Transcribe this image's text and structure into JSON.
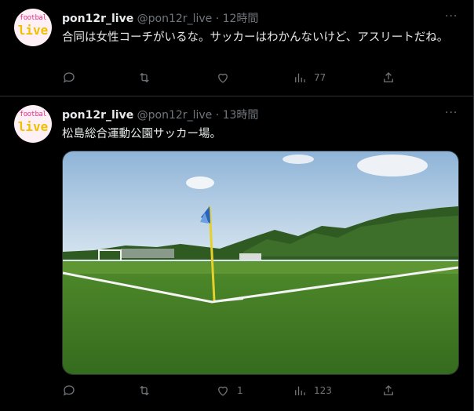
{
  "colors": {
    "background": "#000000",
    "text_primary": "#e7e9ea",
    "text_secondary": "#71767b",
    "border": "#2f3336"
  },
  "tweets": [
    {
      "avatar_text_top": "footbal",
      "avatar_text_main": "live",
      "display_name": "pon12r_live",
      "handle": "@pon12r_live",
      "separator": "·",
      "time": "12時間",
      "more_label": "···",
      "text": "合同は女性コーチがいるな。サッカーはわかんないけど、アスリートだね。",
      "reply_count": "",
      "retweet_count": "",
      "like_count": "",
      "view_count": "77",
      "icons": [
        "reply-icon",
        "retweet-icon",
        "like-icon",
        "views-icon",
        "share-icon"
      ]
    },
    {
      "avatar_text_top": "footbal",
      "avatar_text_main": "live",
      "display_name": "pon12r_live",
      "handle": "@pon12r_live",
      "separator": "·",
      "time": "13時間",
      "more_label": "···",
      "text": "松島総合運動公園サッカー場。",
      "reply_count": "",
      "retweet_count": "",
      "like_count": "1",
      "view_count": "123",
      "icons": [
        "reply-icon",
        "retweet-icon",
        "like-icon",
        "views-icon",
        "share-icon"
      ]
    }
  ]
}
